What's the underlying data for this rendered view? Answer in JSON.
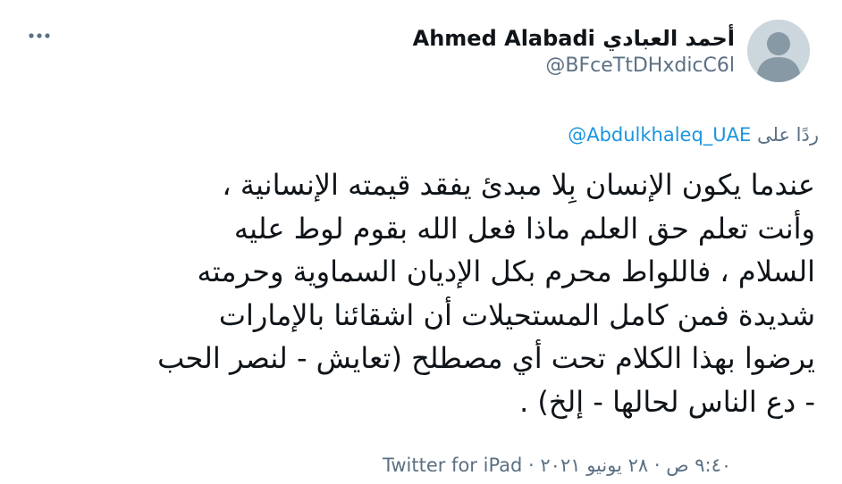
{
  "author": {
    "display_name": "أحمد العبادي Ahmed Alabadi",
    "handle": "@BFceTtDHxdicC6l",
    "avatar_icon": "default-profile-icon"
  },
  "menu": {
    "icon": "more-horizontal-icon"
  },
  "reply": {
    "prefix": "ردًا على",
    "mention": "@Abdulkhaleq_UAE"
  },
  "tweet": {
    "text": "عندما يكون الإنسان بِلا مبدئ يفقد قيمته الإنسانية ،\nوأنت تعلم حق العلم ماذا فعل الله بقوم لوط عليه\nالسلام ، فاللواط محرم بكل الإديان السماوية وحرمته\nشديدة فمن كامل المستحيلات أن اشقائنا بالإمارات\nيرضوا بهذا الكلام تحت أي مصطلح (تعايش - لنصر الحب\n- دع الناس لحالها - إلخ) ."
  },
  "meta": {
    "timestamp": "٩:٤٠ ص · ٢٨ يونيو ٢٠٢١",
    "separator": " · ",
    "source": "Twitter for iPad"
  },
  "colors": {
    "text": "#0f1419",
    "secondary": "#5b7083",
    "link": "#1b95e0",
    "avatar_bg": "#ccd6dd"
  }
}
